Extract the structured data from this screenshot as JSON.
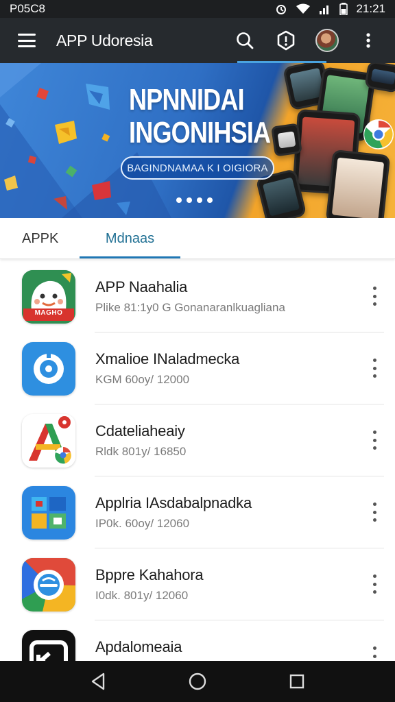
{
  "status_bar": {
    "left_text": "P05C8",
    "time": "21:21"
  },
  "app_bar": {
    "title": "APP Udoresia"
  },
  "banner": {
    "title_line1": "NPNNIDAI",
    "title_line2": "INGONIHSIA",
    "pill_text": "BAGINDNAMAA K I OIGIORA"
  },
  "tabs": [
    {
      "label": "APPK"
    },
    {
      "label": "Mdnaas"
    }
  ],
  "apps": [
    {
      "title": "APP Naahalia",
      "subtitle": "Plike 81:1y0 G Gonanaranlkuagliana",
      "icon_label": "MAGHO"
    },
    {
      "title": "Xmalioe INaladmecka",
      "subtitle": "KGM 60oy/ 12000"
    },
    {
      "title": "Cdateliaheaiy",
      "subtitle": "Rldk 801y/ 16850"
    },
    {
      "title": "Applria IAsdabalpnadka",
      "subtitle": "IP0k. 60oy/ 12060"
    },
    {
      "title": "Bppre Kahahora",
      "subtitle": "I0dk. 801y/ 12060"
    },
    {
      "title": "Apdalomeaia",
      "subtitle": ""
    }
  ],
  "colors": {
    "app_bar": "#262a2e",
    "accent": "#1f77b4",
    "banner_blue": "#2f6fc4",
    "banner_orange": "#f6b33a"
  },
  "icons": [
    "menu-icon",
    "search-icon",
    "notification-icon",
    "avatar",
    "more-vert-icon",
    "back-icon",
    "home-icon",
    "recents-icon"
  ]
}
